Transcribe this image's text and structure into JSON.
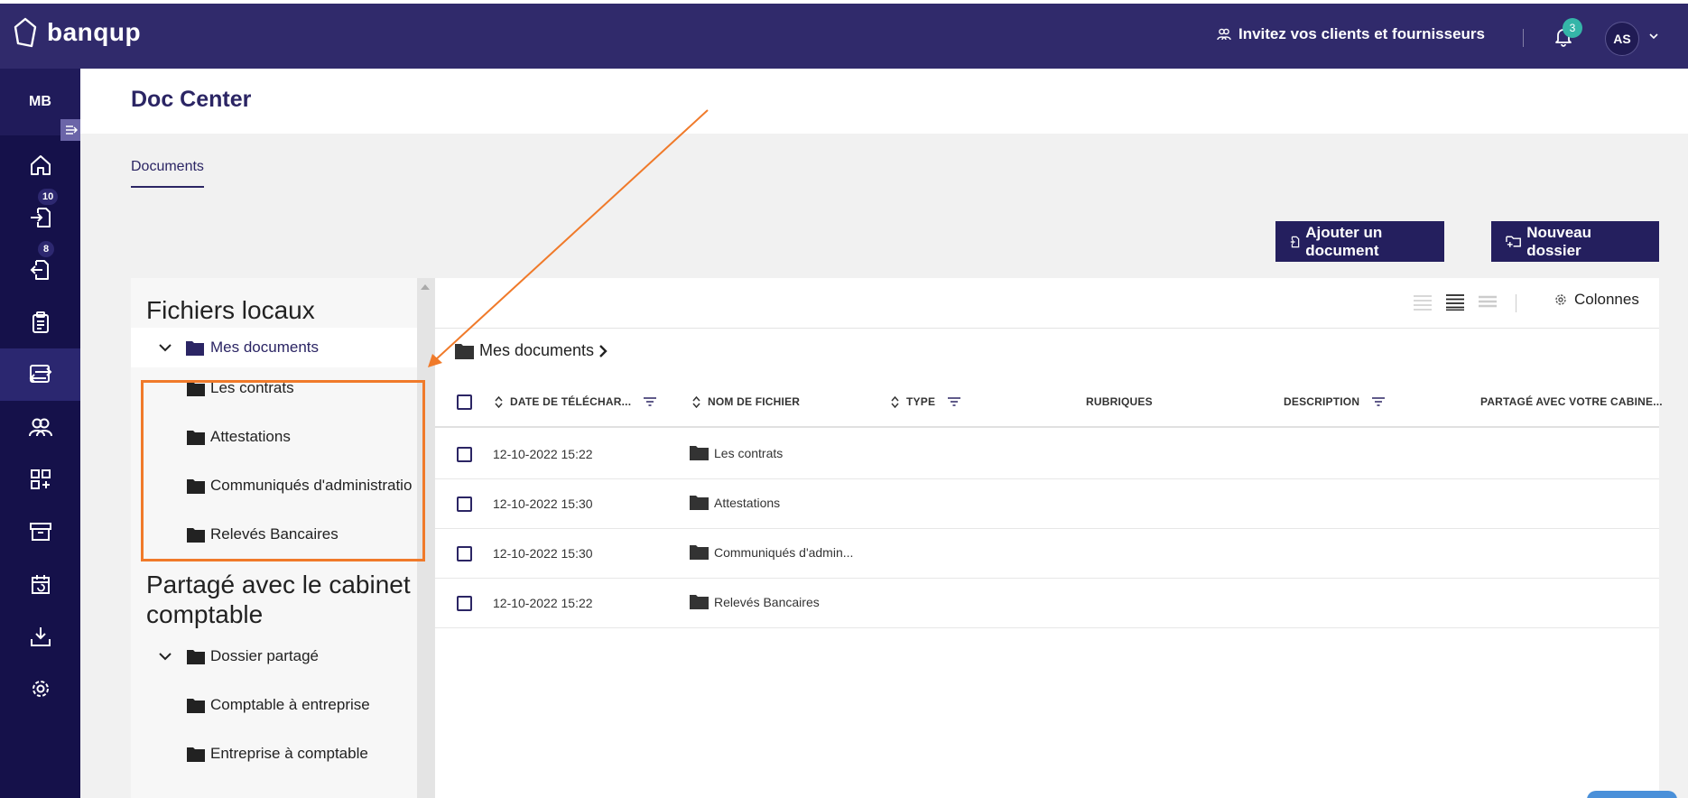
{
  "app": {
    "brand": "banqup"
  },
  "topbar": {
    "invite_label": "Invitez vos clients et fournisseurs",
    "notification_count": "3",
    "user_initials": "AS"
  },
  "sidebar": {
    "org_initials": "MB",
    "items": [
      {
        "icon": "home-icon"
      },
      {
        "icon": "inbox-in-icon",
        "badge": "10"
      },
      {
        "icon": "outbox-out-icon",
        "badge": "8"
      },
      {
        "icon": "clipboard-icon"
      },
      {
        "icon": "transfer-icon",
        "active": true
      },
      {
        "icon": "contacts-icon"
      },
      {
        "icon": "apps-add-icon"
      },
      {
        "icon": "archive-icon"
      },
      {
        "icon": "calendar-sync-icon"
      },
      {
        "icon": "download-tray-icon"
      },
      {
        "icon": "settings-gear-icon"
      }
    ]
  },
  "page": {
    "title": "Doc Center",
    "tab": "Documents",
    "add_document_label": "Ajouter un document",
    "new_folder_label": "Nouveau dossier"
  },
  "tree": {
    "local_heading": "Fichiers locaux",
    "root": "Mes documents",
    "local_folders": [
      "Les contrats",
      "Attestations",
      "Communiqués d'administratio",
      "Relevés Bancaires"
    ],
    "shared_heading": "Partagé avec le cabinet comptable",
    "shared_root": "Dossier partagé",
    "shared_folders": [
      "Comptable à entreprise",
      "Entreprise à comptable"
    ]
  },
  "table": {
    "columns_label": "Colonnes",
    "breadcrumb": "Mes documents",
    "headers": {
      "date": "DATE DE TÉLÉCHAR...",
      "name": "NOM DE FICHIER",
      "type": "TYPE",
      "rubriques": "RUBRIQUES",
      "description": "DESCRIPTION",
      "shared": "PARTAGÉ AVEC VOTRE CABINE..."
    },
    "rows": [
      {
        "date": "12-10-2022 15:22",
        "name": "Les contrats"
      },
      {
        "date": "12-10-2022 15:30",
        "name": "Attestations"
      },
      {
        "date": "12-10-2022 15:30",
        "name": "Communiqués d'admin..."
      },
      {
        "date": "12-10-2022 15:22",
        "name": "Relevés Bancaires"
      }
    ]
  },
  "colors": {
    "brand_dark": "#302a6b",
    "sidebar": "#15114a",
    "accent_badge": "#35b5a8",
    "annotation": "#f07a2a"
  }
}
